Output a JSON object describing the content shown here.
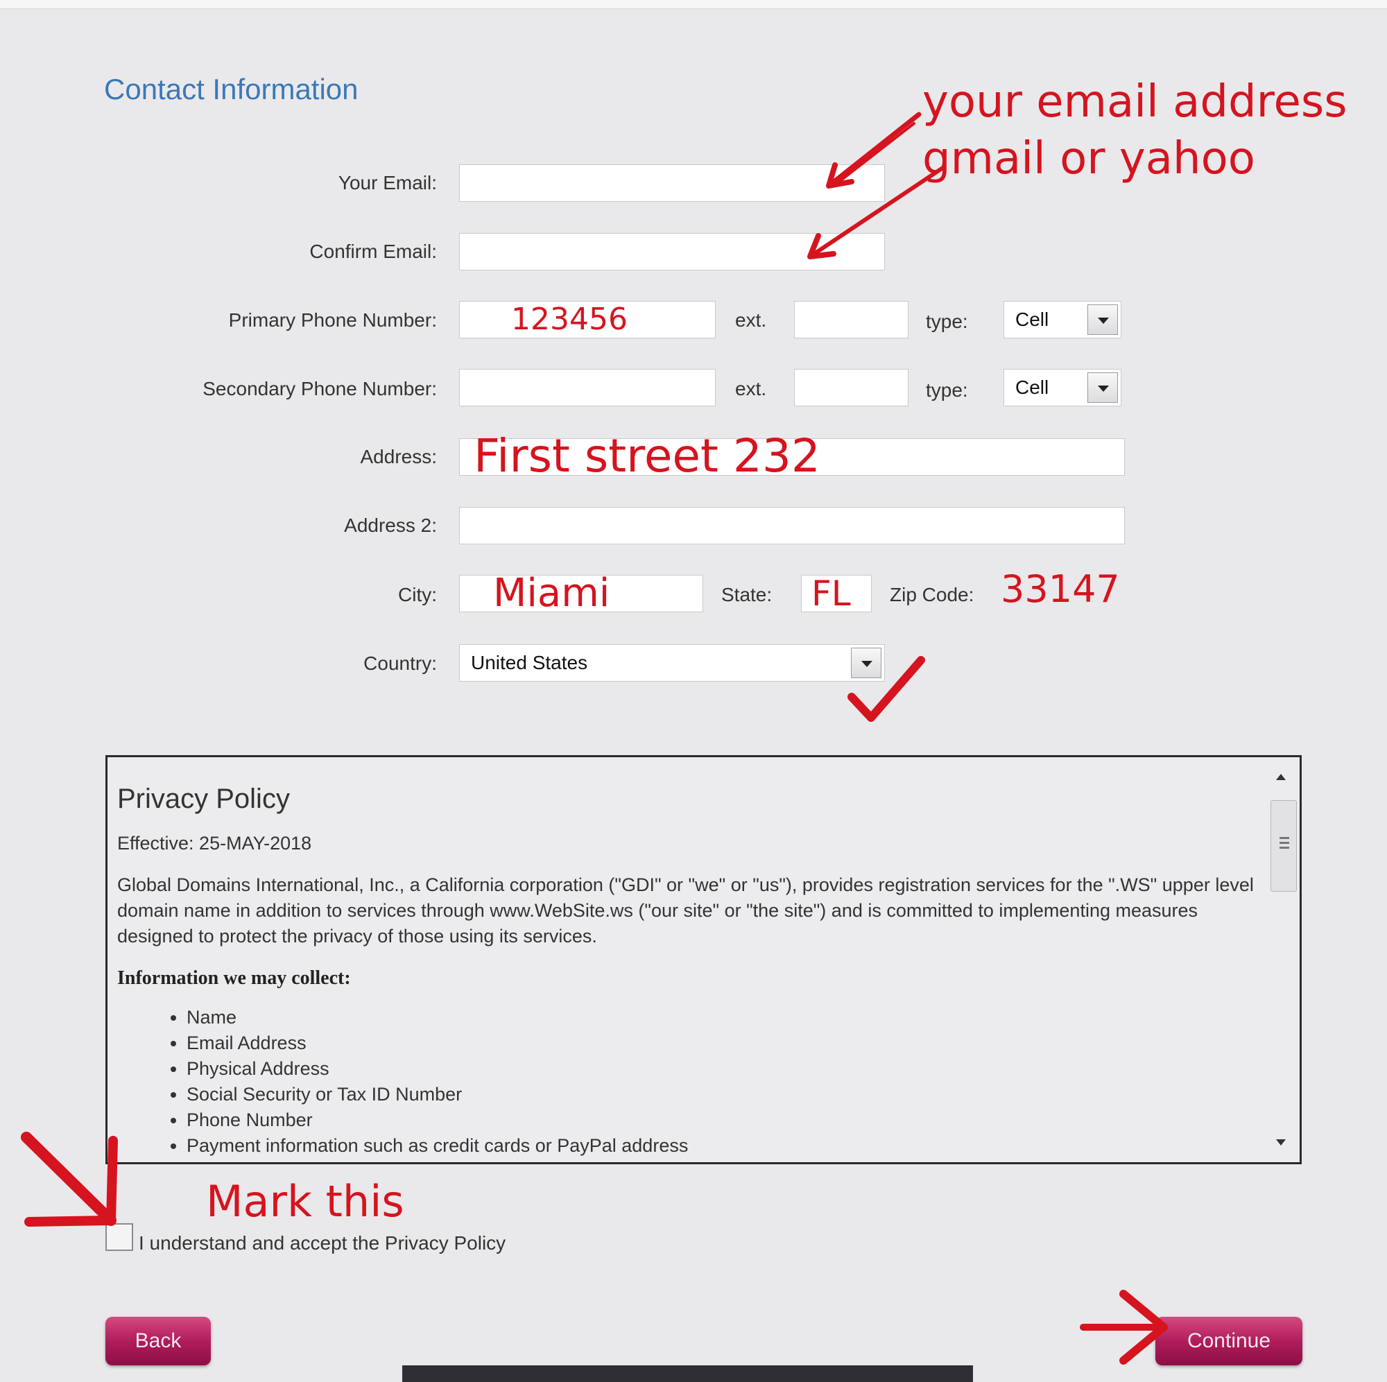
{
  "section_title": "Contact Information",
  "fields": {
    "email_label": "Your Email:",
    "confirm_email_label": "Confirm Email:",
    "primary_phone_label": "Primary Phone Number:",
    "primary_phone_value": "123456",
    "primary_ext_label": "ext.",
    "primary_type_label": "type:",
    "primary_type_value": "Cell",
    "secondary_phone_label": "Secondary Phone Number:",
    "secondary_ext_label": "ext.",
    "secondary_type_label": "type:",
    "secondary_type_value": "Cell",
    "address_label": "Address:",
    "address_value": "First street 232",
    "address2_label": "Address 2:",
    "city_label": "City:",
    "city_value": "Miami",
    "state_label": "State:",
    "state_value": "FL",
    "zip_label": "Zip Code:",
    "zip_value": "33147",
    "country_label": "Country:",
    "country_value": "United States"
  },
  "annotations": {
    "email_note_line1": "your email address",
    "email_note_line2": "gmail or yahoo",
    "mark_this": "Mark this"
  },
  "policy": {
    "title": "Privacy Policy",
    "effective": "Effective: 25-MAY-2018",
    "paragraph": "Global Domains International, Inc., a California corporation (\"GDI\" or \"we\" or \"us\"), provides registration services for the \".WS\" upper level domain name in addition to services through www.WebSite.ws (\"our site\" or \"the site\") and is committed to implementing measures designed to protect the privacy of those using its services.",
    "subheading": "Information we may collect:",
    "items": [
      "Name",
      "Email Address",
      "Physical Address",
      "Social Security or Tax ID Number",
      "Phone Number",
      "Payment information such as credit cards or PayPal address"
    ]
  },
  "accept_label": "I understand and accept the Privacy Policy",
  "buttons": {
    "back": "Back",
    "continue": "Continue"
  },
  "colors": {
    "annotation_red": "#d5141f",
    "title_blue": "#3b78b8",
    "button_magenta": "#b01d5b"
  }
}
